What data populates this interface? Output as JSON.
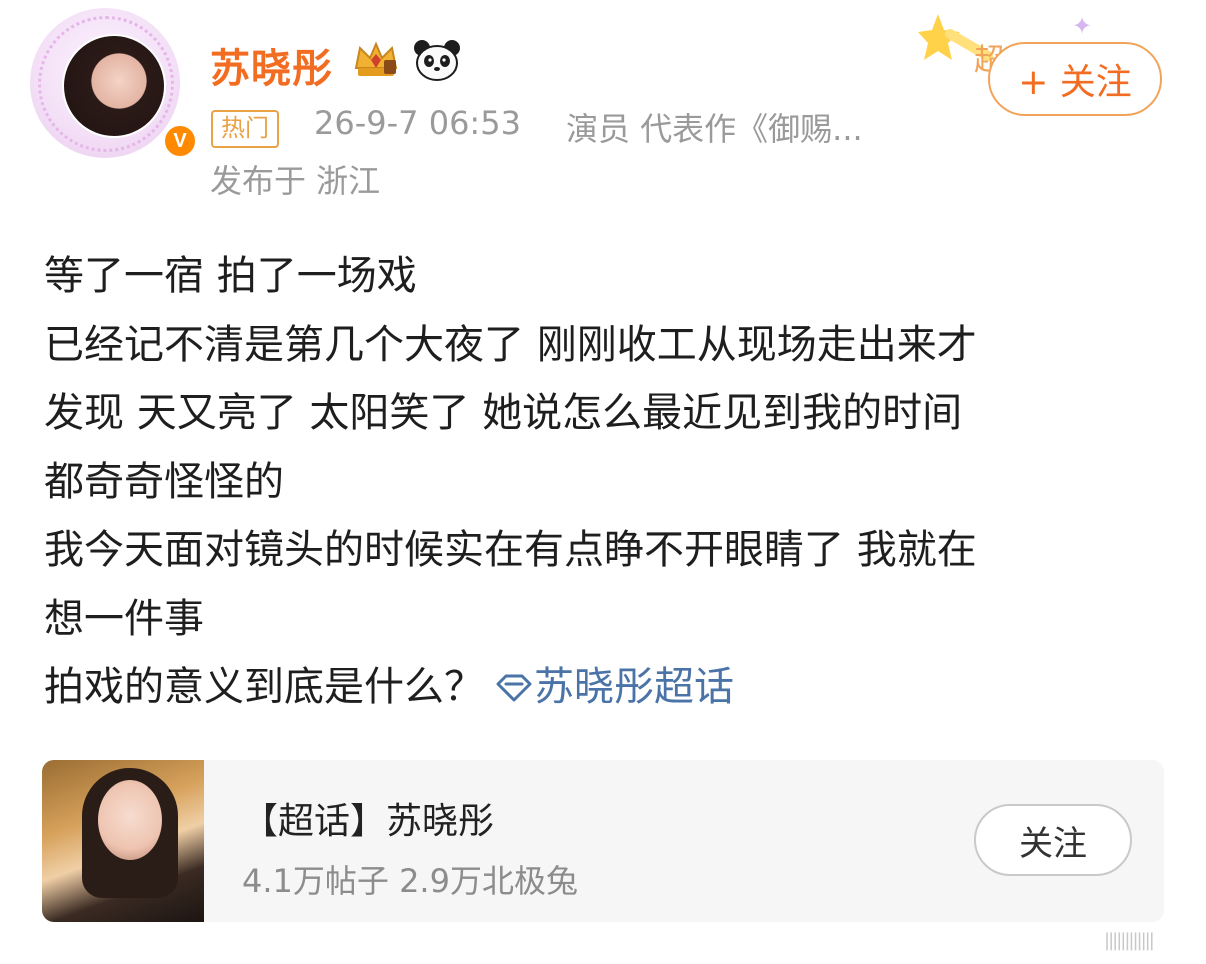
{
  "post": {
    "author": {
      "name": "苏晓彤",
      "verified_badge": "V",
      "badge_icons": [
        "crown-icon",
        "panda-icon"
      ]
    },
    "hot_tag": "热门",
    "time": "26-9-7 06:53",
    "desc": "演员 代表作《御赐...",
    "location": "发布于 浙江",
    "follow_label": "+ 关注",
    "decor_text": "超",
    "body_lines": [
      "等了一宿 拍了一场戏",
      "已经记不清是第几个大夜了 刚刚收工从现场走出来才",
      "发现 天又亮了 太阳笑了 她说怎么最近见到我的时间",
      "都奇奇怪怪的",
      "我今天面对镜头的时候实在有点睁不开眼睛了 我就在",
      "想一件事"
    ],
    "last_line_text": "拍戏的意义到底是什么？",
    "topic_link": "苏晓彤超话"
  },
  "supertopic_card": {
    "title": "【超话】苏晓彤",
    "stats": "4.1万帖子 2.9万北极兔",
    "follow_label": "关注"
  },
  "colors": {
    "username": "#f26d21",
    "meta": "#9a9a9a",
    "topic_link": "#4a73a8",
    "hot_badge": "#e9a245",
    "card_bg": "#f6f6f6"
  }
}
